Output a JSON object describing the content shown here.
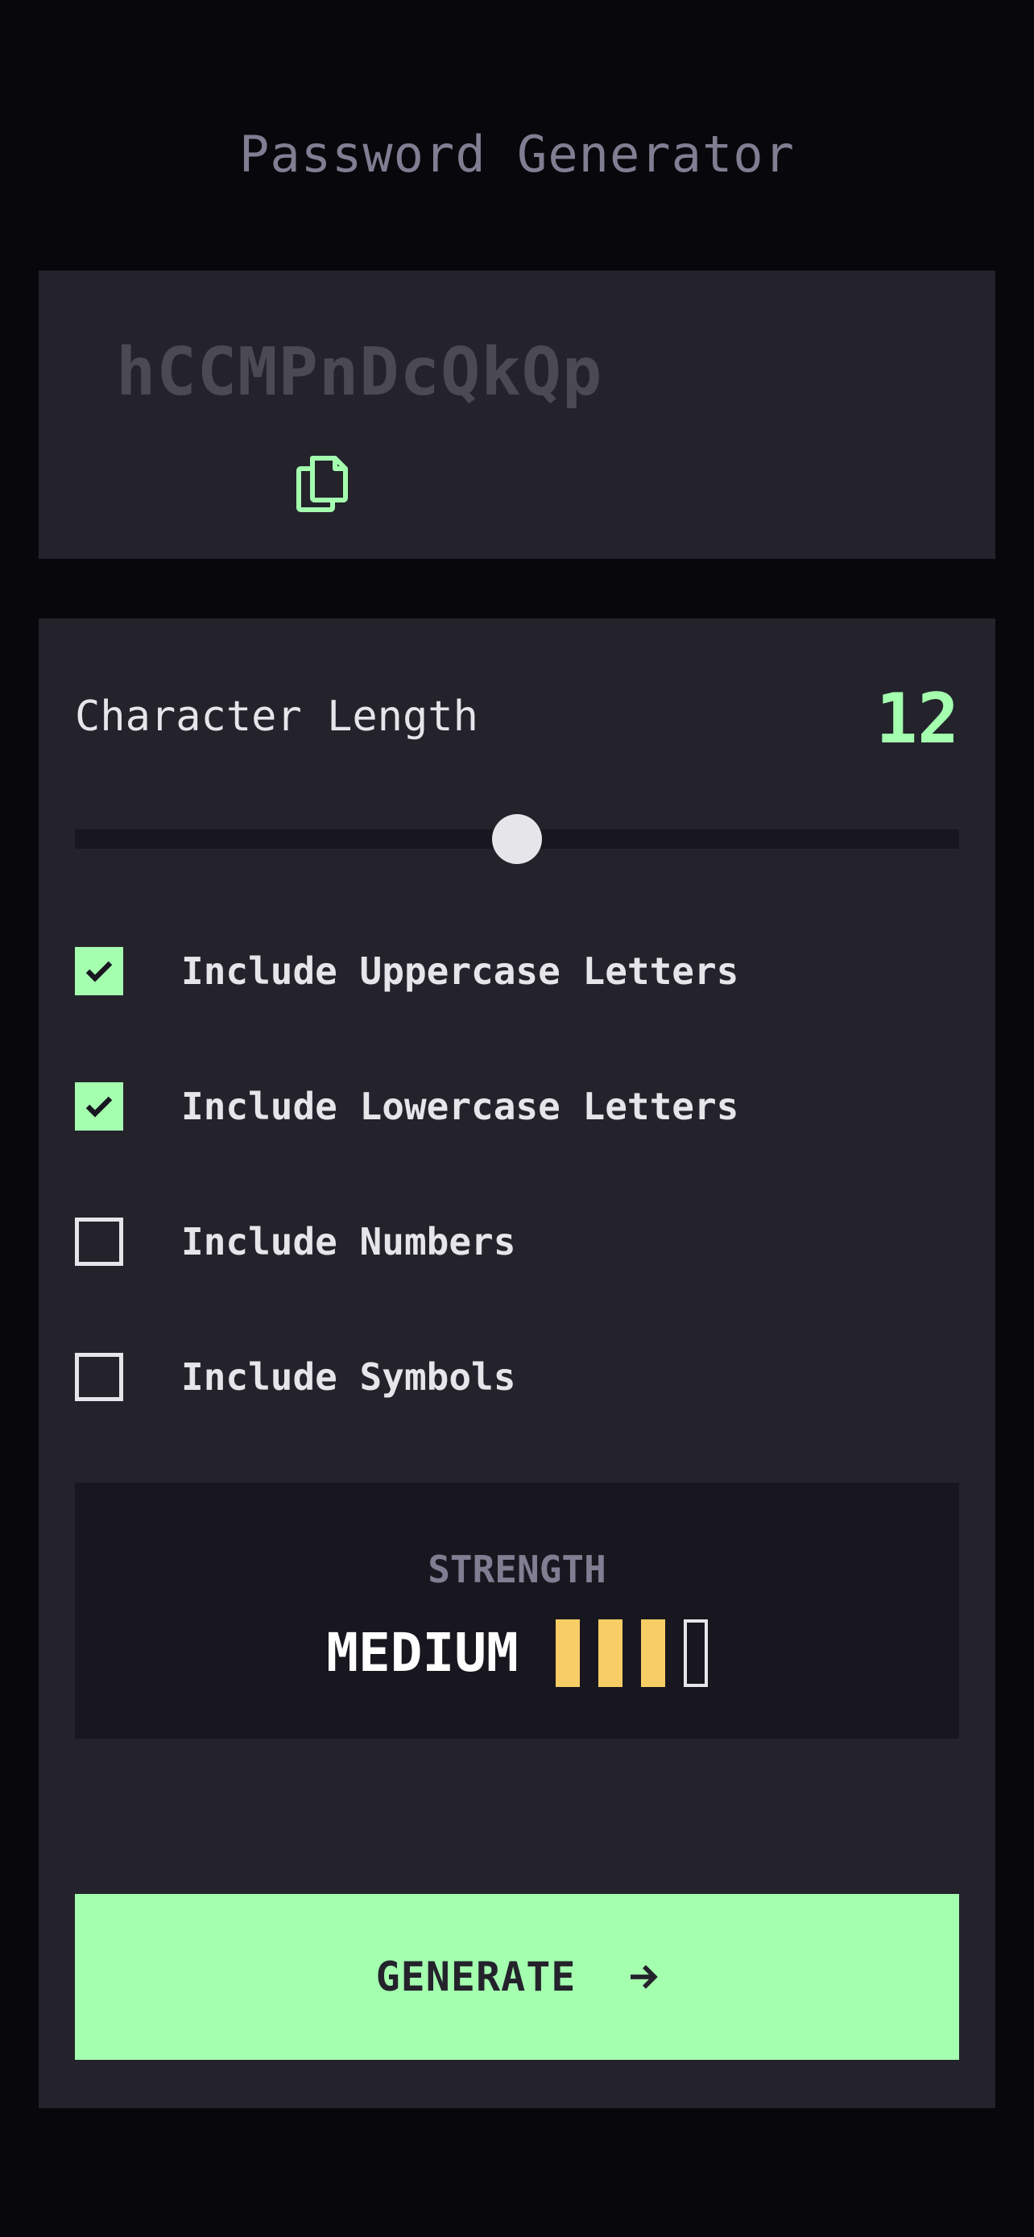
{
  "app": {
    "title": "Password Generator"
  },
  "output": {
    "password": "hCCMPnDcQkQp",
    "copy_icon": "copy-icon"
  },
  "length": {
    "label": "Character Length",
    "value": "12",
    "slider_fraction": 0.5
  },
  "options": [
    {
      "label": "Include Uppercase Letters",
      "checked": true
    },
    {
      "label": "Include Lowercase Letters",
      "checked": true
    },
    {
      "label": "Include Numbers",
      "checked": false
    },
    {
      "label": "Include Symbols",
      "checked": false
    }
  ],
  "strength": {
    "label": "STRENGTH",
    "value": "MEDIUM",
    "level": 3,
    "max_level": 4
  },
  "generate": {
    "label": "GENERATE",
    "icon": "arrow-right-icon"
  },
  "colors": {
    "accent": "#a4ffaf",
    "medium": "#f8cd65",
    "panel": "#24232c",
    "background": "#08070b"
  }
}
